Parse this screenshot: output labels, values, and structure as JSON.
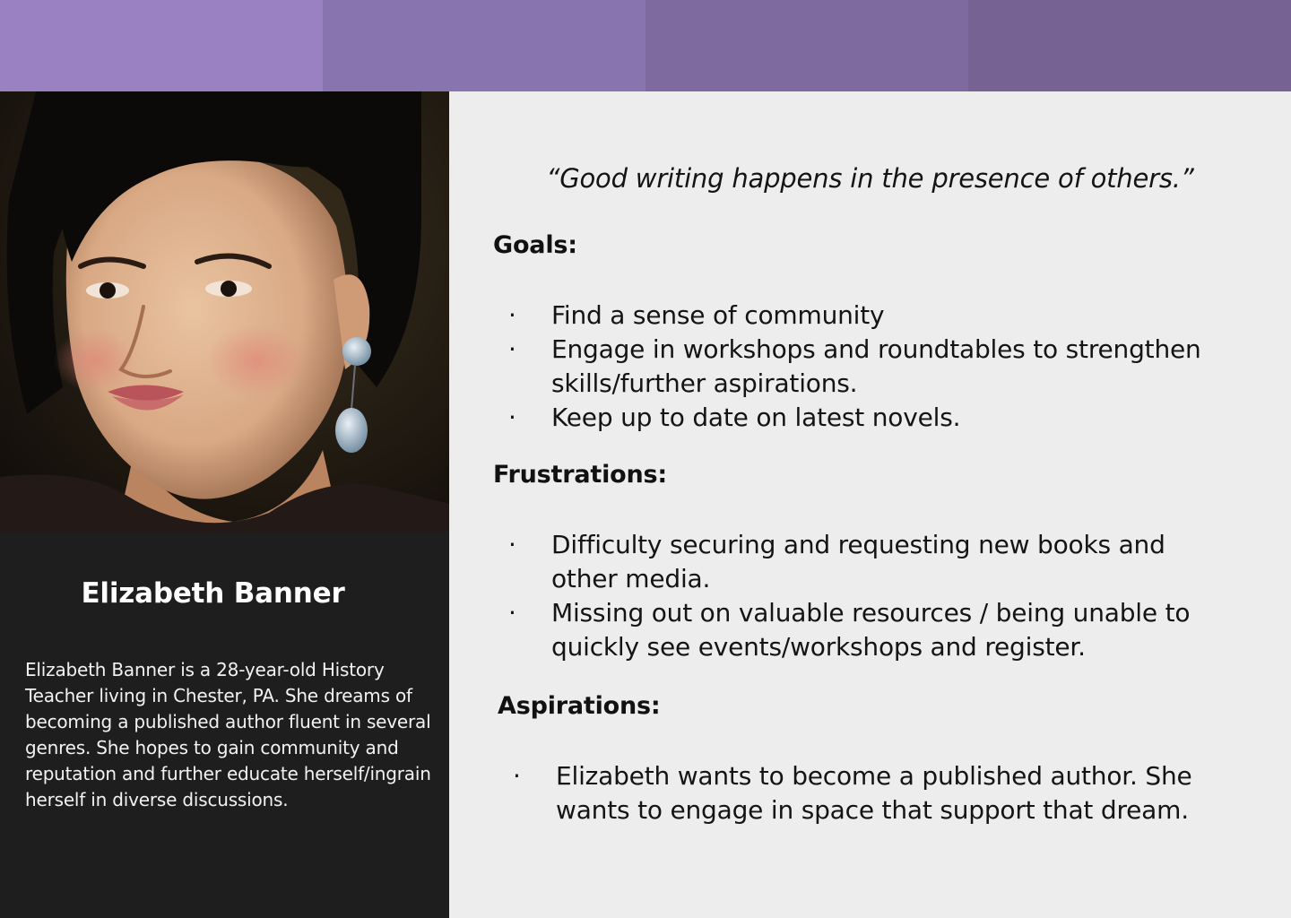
{
  "colors": {
    "band": [
      "#9a82c2",
      "#8874ae",
      "#7f6aa0",
      "#766293"
    ],
    "left_panel_bg": "#1e1e1e",
    "right_panel_bg": "#ededed"
  },
  "persona": {
    "name": "Elizabeth Banner",
    "bio": "Elizabeth Banner is a 28-year-old History Teacher living in Chester, PA. She dreams of becoming a published author fluent in several genres. She hopes to gain community and reputation and further educate herself/ingrain herself in diverse discussions."
  },
  "quote": "“Good writing happens in the presence of others.”",
  "sections": {
    "goals": {
      "title": "Goals:",
      "items": [
        "Find a sense of community",
        "Engage in workshops and roundtables to strengthen skills/further aspirations.",
        "Keep up to date on latest novels."
      ]
    },
    "frustrations": {
      "title": "Frustrations:",
      "items": [
        "Difficulty securing and requesting new books and other media.",
        "Missing out on valuable resources / being unable to quickly see events/workshops and register."
      ]
    },
    "aspirations": {
      "title": "Aspirations:",
      "items": [
        "Elizabeth wants to become a published author. She wants to engage in space that support that dream."
      ]
    }
  },
  "bullet_glyph": "·"
}
